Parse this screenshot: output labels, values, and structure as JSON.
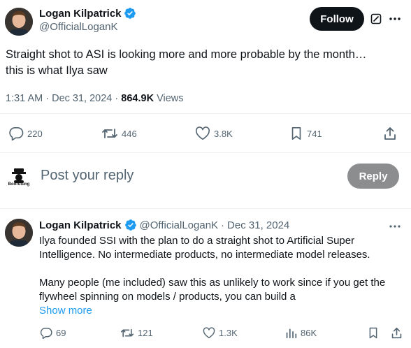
{
  "main_tweet": {
    "author_name": "Logan Kilpatrick",
    "author_handle": "@OfficialLoganK",
    "follow_label": "Follow",
    "text_line1": "Straight shot to ASI is looking more and more probable by the month…",
    "text_line2": "this is what Ilya saw",
    "time": "1:31 AM",
    "date": "Dec 31, 2024",
    "views_count": "864.9K",
    "views_label": "Views",
    "separator": "·",
    "stats": {
      "replies": "220",
      "retweets": "446",
      "likes": "3.8K",
      "bookmarks": "741"
    }
  },
  "composer": {
    "logo_text": "Boorutung",
    "placeholder": "Post your reply",
    "reply_label": "Reply"
  },
  "reply_tweet": {
    "author_name": "Logan Kilpatrick",
    "author_handle": "@OfficialLoganK",
    "separator": "·",
    "date": "Dec 31, 2024",
    "para1_line1": "Ilya founded SSI with the plan to do a straight shot to Artificial Super",
    "para1_line2": "Intelligence. No intermediate products, no intermediate model releases.",
    "para2_line1": "Many people (me included) saw this as unlikely to work since if you get the",
    "para2_line2": "flywheel spinning on models / products, you can build a",
    "show_more": "Show more",
    "stats": {
      "replies": "69",
      "retweets": "121",
      "likes": "1.3K",
      "views": "86K"
    }
  },
  "colors": {
    "text": "#0f1419",
    "secondary": "#536471",
    "accent": "#1d9bf0",
    "verified": "#1d9bf0"
  },
  "icons": [
    "verified-badge-icon",
    "grok-icon",
    "more-icon",
    "reply-icon",
    "retweet-icon",
    "like-icon",
    "bookmark-icon",
    "share-icon",
    "views-icon"
  ]
}
